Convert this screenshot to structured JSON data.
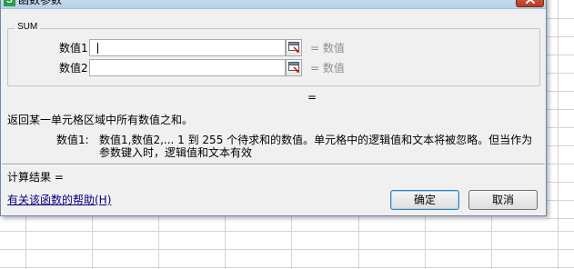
{
  "dialog": {
    "title": "函数参数",
    "app_icon_letter": "S",
    "function_name": "SUM",
    "arguments": [
      {
        "label": "数值1",
        "value": "",
        "result": "= 数值"
      },
      {
        "label": "数值2",
        "value": "",
        "result": "= 数值"
      }
    ],
    "formula_result": "=",
    "description": "返回某一单元格区域中所有数值之和。",
    "param_name": "数值1:",
    "param_description": "数值1,数值2,... 1 到 255 个待求和的数值。单元格中的逻辑值和文本将被忽略。但当作为参数键入时，逻辑值和文本有效",
    "calc_result_label": "计算结果 =",
    "help_link": "有关该函数的帮助(H)",
    "ok_label": "确定",
    "cancel_label": "取消"
  },
  "colors": {
    "dialog_bg": "#f0f0f0",
    "title_bar": "#b9d1ea",
    "close_button": "#c84f37",
    "link": "#00007f",
    "hint_text": "#8e8e8e"
  },
  "icons": {
    "app": "wps-spreadsheet-icon",
    "close": "close-icon",
    "reference": "collapse-dialog-icon"
  }
}
